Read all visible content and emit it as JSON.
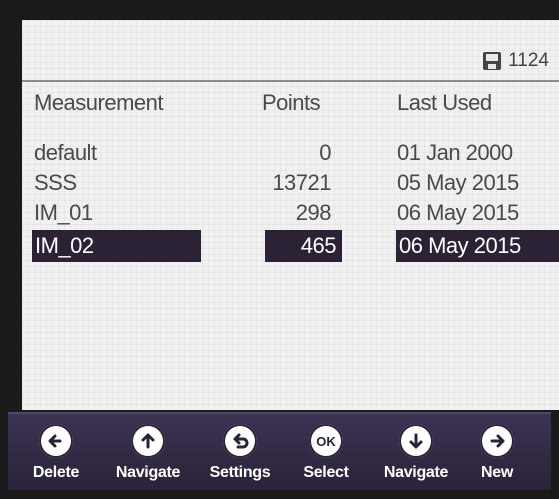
{
  "status": {
    "value": "1124",
    "icon": "save-disk-icon"
  },
  "table": {
    "headers": [
      "Measurement",
      "Points",
      "Last Used"
    ],
    "rows": [
      {
        "measurement": "default",
        "points": "0",
        "last_used": "01 Jan 2000"
      },
      {
        "measurement": "SSS",
        "points": "13721",
        "last_used": "05 May 2015"
      },
      {
        "measurement": "IM_01",
        "points": "298",
        "last_used": "06 May 2015"
      },
      {
        "measurement": "IM_02",
        "points": "465",
        "last_used": "06 May 2015"
      }
    ],
    "selected_row": 3
  },
  "toolbar": {
    "buttons": [
      {
        "label": "Delete",
        "icon": "arrow-left-icon"
      },
      {
        "label": "Navigate",
        "icon": "arrow-up-icon"
      },
      {
        "label": "Settings",
        "icon": "back-arrow-icon"
      },
      {
        "label": "Select",
        "icon": "ok-icon",
        "icon_text": "OK"
      },
      {
        "label": "Navigate",
        "icon": "arrow-down-icon"
      },
      {
        "label": "New",
        "icon": "arrow-right-icon"
      }
    ]
  },
  "colors": {
    "screen_bg": "#f1f1f1",
    "toolbar_bg": "#2b2236",
    "highlight": "#2b2236",
    "text": "#4a4a4a"
  }
}
